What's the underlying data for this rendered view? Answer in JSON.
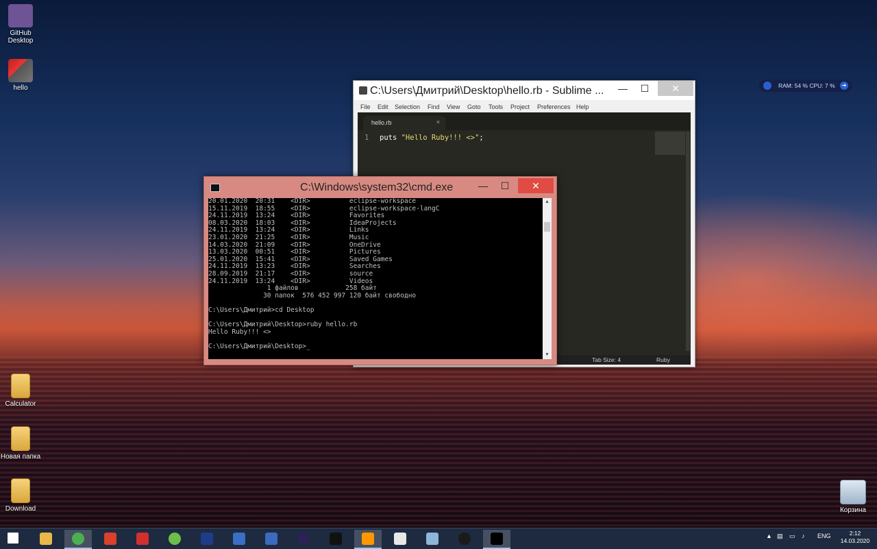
{
  "desktop": {
    "icons_left": [
      {
        "label_line1": "GitHub",
        "label_line2": "Desktop",
        "icon": "github-icon"
      },
      {
        "label_line1": "hello",
        "label_line2": "",
        "icon": "hello-file-icon"
      },
      {
        "label_line1": "Calculator",
        "label_line2": "",
        "icon": "folder-icon"
      },
      {
        "label_line1": "Новая папка",
        "label_line2": "",
        "icon": "folder-icon"
      },
      {
        "label_line1": "Download",
        "label_line2": "",
        "icon": "folder-icon"
      }
    ],
    "recycle_bin": {
      "label": "Корзина",
      "icon": "recycle-bin-icon"
    }
  },
  "gadget": {
    "text": "RAM: 54 %  CPU: 7 %"
  },
  "sublime": {
    "title": "C:\\Users\\Дмитрий\\Desktop\\hello.rb - Sublime ...",
    "menu": [
      "File",
      "Edit",
      "Selection",
      "Find",
      "View",
      "Goto",
      "Tools",
      "Project",
      "Preferences",
      "Help"
    ],
    "tab": {
      "label": "hello.rb",
      "close": "×"
    },
    "line_number": "1",
    "code_keyword": "puts ",
    "code_string": "\"Hello Ruby!!! <>\"",
    "code_end": ";",
    "status": {
      "tab_size": "Tab Size: 4",
      "syntax": "Ruby"
    },
    "buttons": {
      "minimize": "—",
      "maximize": "☐",
      "close": "✕"
    }
  },
  "cmd": {
    "title": "C:\\Windows\\system32\\cmd.exe",
    "buttons": {
      "minimize": "—",
      "maximize": "☐",
      "close": "✕"
    },
    "lines": [
      "20.01.2020  20:31    <DIR>          eclipse-workspace",
      "15.11.2019  18:55    <DIR>          eclipse-workspace-langC",
      "24.11.2019  13:24    <DIR>          Favorites",
      "08.03.2020  18:03    <DIR>          IdeaProjects",
      "24.11.2019  13:24    <DIR>          Links",
      "23.01.2020  21:25    <DIR>          Music",
      "14.03.2020  21:09    <DIR>          OneDrive",
      "13.03.2020  00:51    <DIR>          Pictures",
      "25.01.2020  15:41    <DIR>          Saved Games",
      "24.11.2019  13:23    <DIR>          Searches",
      "28.09.2019  21:17    <DIR>          source",
      "24.11.2019  13:24    <DIR>          Videos",
      "               1 файлов            258 байт",
      "              30 папок  576 452 997 120 байт свободно",
      "",
      "C:\\Users\\Дмитрий>cd Desktop",
      "",
      "C:\\Users\\Дмитрий\\Desktop>ruby hello.rb",
      "Hello Ruby!!! <>",
      "",
      "C:\\Users\\Дмитрий\\Desktop>_"
    ]
  },
  "taskbar": {
    "apps": [
      {
        "name": "start-icon",
        "color": "#ffffff"
      },
      {
        "name": "file-explorer-icon",
        "color": "#e8b84a"
      },
      {
        "name": "chrome-icon",
        "color": "#4caf50"
      },
      {
        "name": "ccleaner-icon",
        "color": "#d9412c"
      },
      {
        "name": "acrobat-icon",
        "color": "#d32f2f"
      },
      {
        "name": "utorrent-icon",
        "color": "#6cc04a"
      },
      {
        "name": "photoshop-icon",
        "color": "#1f3c88"
      },
      {
        "name": "save-floppy-icon",
        "color": "#3a6fc4"
      },
      {
        "name": "devcpp-icon",
        "color": "#3b6bbd"
      },
      {
        "name": "eclipse-icon",
        "color": "#2c2255"
      },
      {
        "name": "intellij-icon",
        "color": "#111111"
      },
      {
        "name": "sublime-text-icon",
        "color": "#ff9800"
      },
      {
        "name": "slack-icon",
        "color": "#e8e8e8"
      },
      {
        "name": "telegram-icon",
        "color": "#8fb5d8"
      },
      {
        "name": "inkscape-icon",
        "color": "#1a1a1a"
      },
      {
        "name": "cmd-icon",
        "color": "#000000"
      }
    ],
    "tray": {
      "lang": "ENG",
      "time": "2:12",
      "date": "14.03.2020"
    }
  }
}
